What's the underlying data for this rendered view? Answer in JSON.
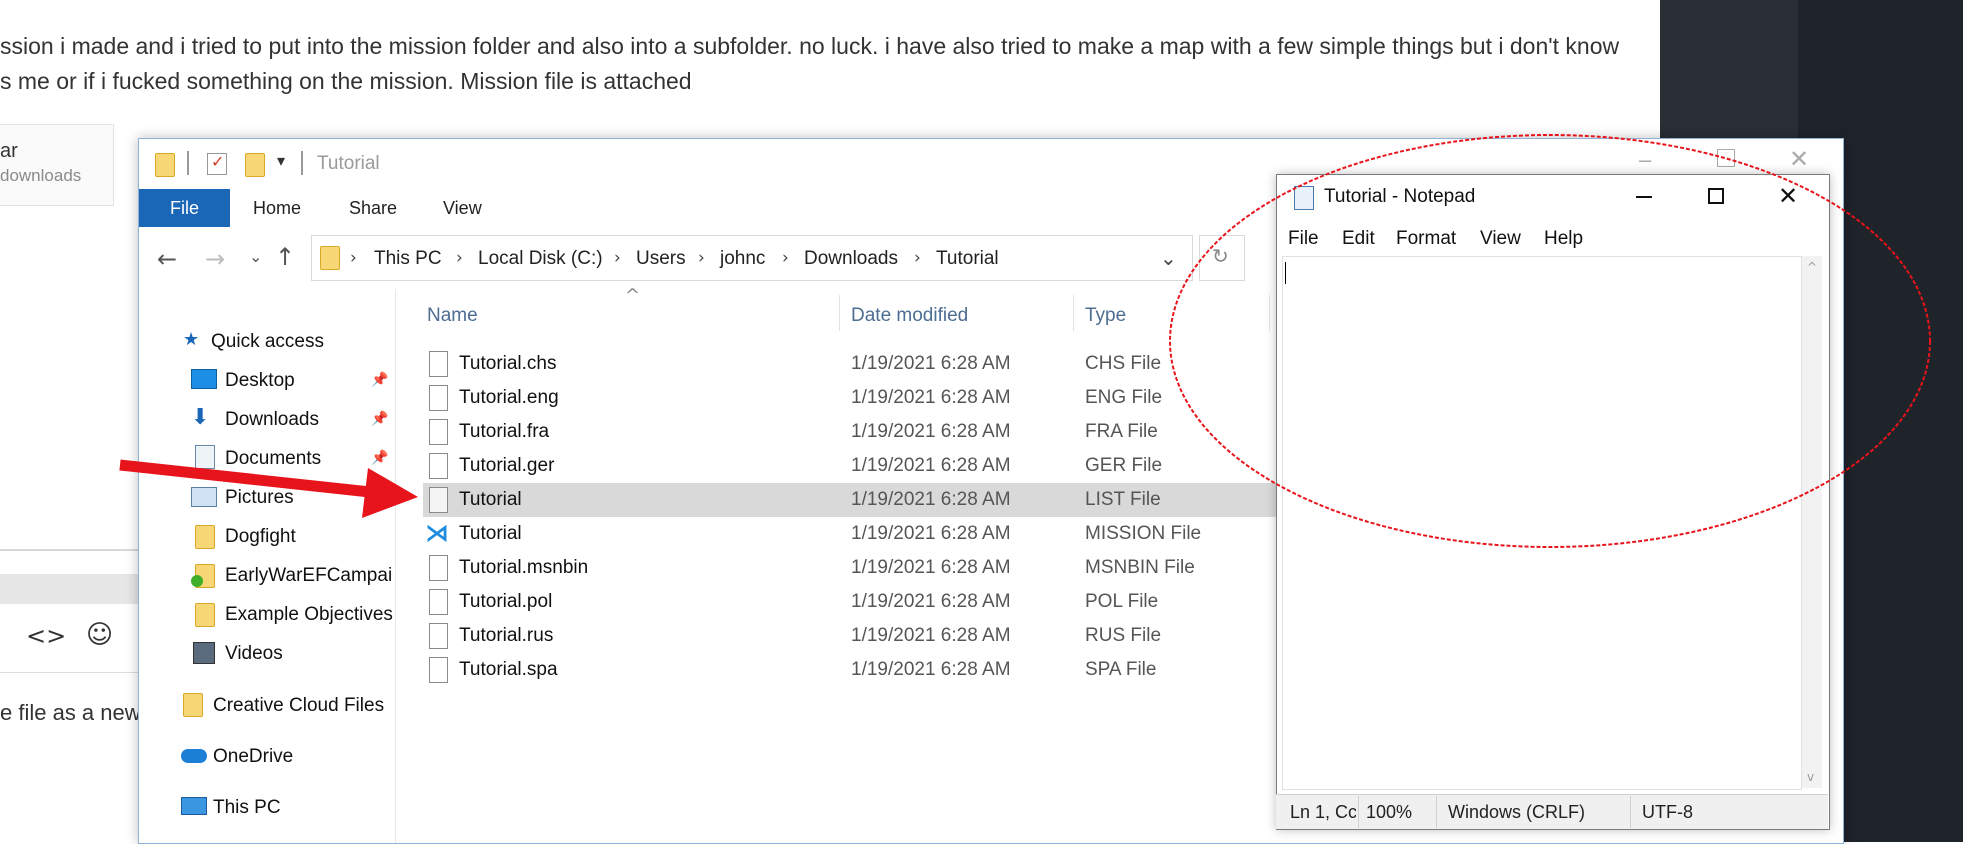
{
  "forum": {
    "line1": "ssion i made and i tried to put into the mission folder and also into a subfolder. no luck. i have also tried to make a map with a few simple things but i don't know",
    "line2": "s me or if i fucked something on the mission. Mission file is attached",
    "attachment_name": "ar",
    "attachment_downloads": "downloads",
    "bottom_text": "e file as a new",
    "code_icon": "<>",
    "smile_icon": "☺"
  },
  "explorer": {
    "title": "Tutorial",
    "tabs": [
      "File",
      "Home",
      "Share",
      "View"
    ],
    "breadcrumb": [
      "This PC",
      "Local Disk (C:)",
      "Users",
      "johnc",
      "Downloads",
      "Tutorial"
    ],
    "nav": {
      "quick_access": "Quick access",
      "desktop": "Desktop",
      "downloads": "Downloads",
      "documents": "Documents",
      "pictures": "Pictures",
      "dogfight": "Dogfight",
      "earlywar": "EarlyWarEFCampaig",
      "example_objectives": "Example Objectives",
      "videos": "Videos",
      "creative_cloud": "Creative Cloud Files",
      "onedrive": "OneDrive",
      "this_pc": "This PC"
    },
    "columns": {
      "name": "Name",
      "date": "Date modified",
      "type": "Type"
    },
    "files": [
      {
        "name": "Tutorial.chs",
        "date": "1/19/2021 6:28 AM",
        "type": "CHS File"
      },
      {
        "name": "Tutorial.eng",
        "date": "1/19/2021 6:28 AM",
        "type": "ENG File"
      },
      {
        "name": "Tutorial.fra",
        "date": "1/19/2021 6:28 AM",
        "type": "FRA File"
      },
      {
        "name": "Tutorial.ger",
        "date": "1/19/2021 6:28 AM",
        "type": "GER File"
      },
      {
        "name": "Tutorial",
        "date": "1/19/2021 6:28 AM",
        "type": "LIST File"
      },
      {
        "name": "Tutorial",
        "date": "1/19/2021 6:28 AM",
        "type": "MISSION File"
      },
      {
        "name": "Tutorial.msnbin",
        "date": "1/19/2021 6:28 AM",
        "type": "MSNBIN File"
      },
      {
        "name": "Tutorial.pol",
        "date": "1/19/2021 6:28 AM",
        "type": "POL File"
      },
      {
        "name": "Tutorial.rus",
        "date": "1/19/2021 6:28 AM",
        "type": "RUS File"
      },
      {
        "name": "Tutorial.spa",
        "date": "1/19/2021 6:28 AM",
        "type": "SPA File"
      }
    ]
  },
  "notepad": {
    "title": "Tutorial - Notepad",
    "menu": [
      "File",
      "Edit",
      "Format",
      "View",
      "Help"
    ],
    "status": {
      "position": "Ln 1, Cc",
      "zoom": "100%",
      "line_ending": "Windows (CRLF)",
      "encoding": "UTF-8"
    }
  },
  "colors": {
    "annotation_red": "#e8141b",
    "ribbon_blue": "#1a66b7",
    "selected_row": "#d9d9d9"
  }
}
